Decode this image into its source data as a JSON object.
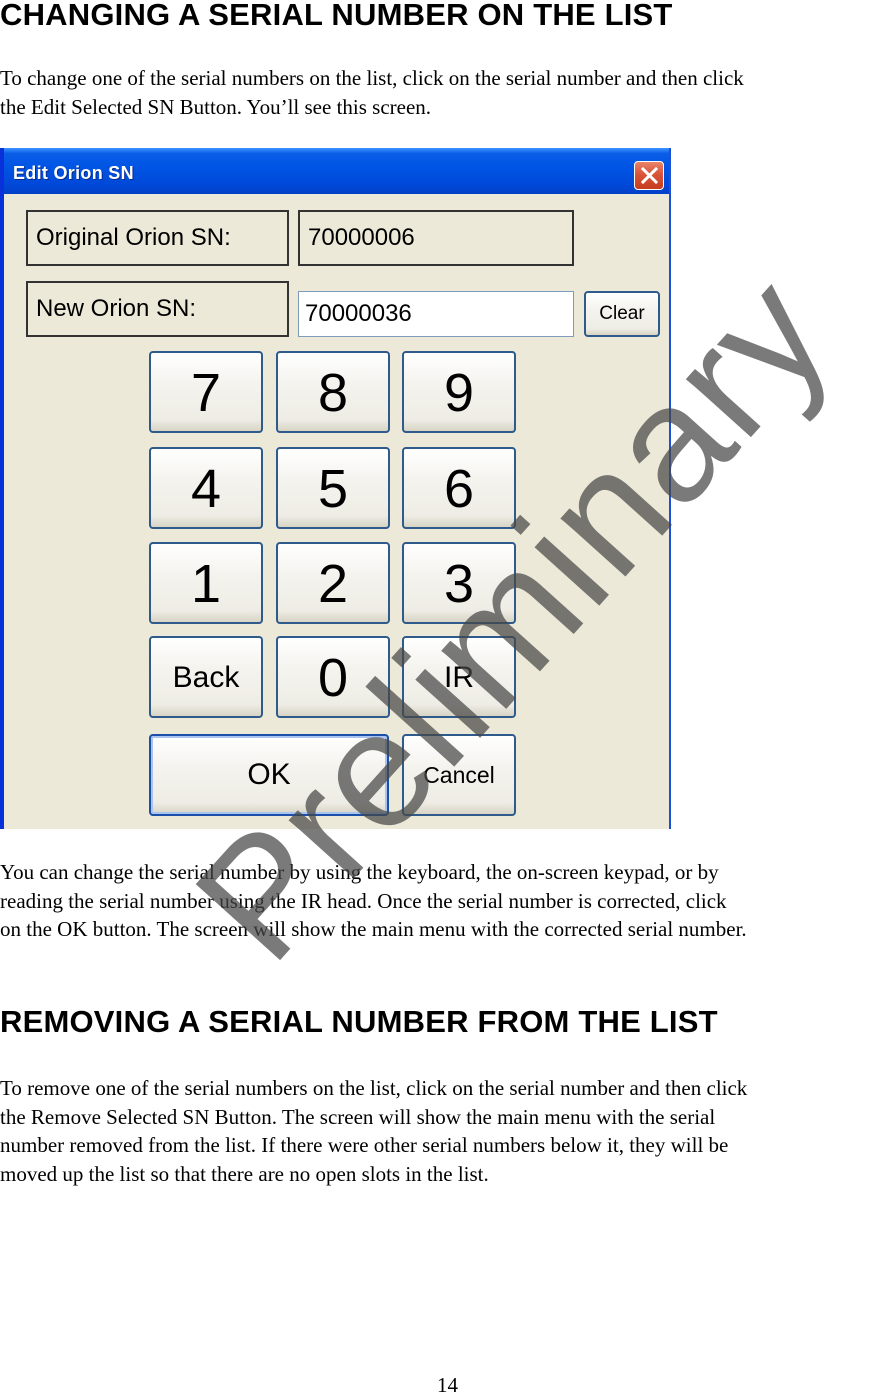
{
  "section1": {
    "heading": "CHANGING A SERIAL NUMBER ON THE LIST",
    "intro": "To change one of the serial numbers on the list, click on the serial number and then click\nthe Edit Selected SN Button.  You’ll see this screen.",
    "after": "You can change the serial number by using the keyboard, the on-screen keypad, or by\nreading the serial number using the IR head.  Once the serial number is corrected, click\non the OK button.  The screen will show the main menu with the corrected serial number."
  },
  "dialog": {
    "title": "Edit Orion SN",
    "close_icon": "close-x-icon",
    "original_label": "Original Orion SN:",
    "original_value": "70000006",
    "new_label": "New Orion SN:",
    "new_value": "70000036",
    "clear_label": "Clear",
    "keypad": {
      "row1": [
        "7",
        "8",
        "9"
      ],
      "row2": [
        "4",
        "5",
        "6"
      ],
      "row3": [
        "1",
        "2",
        "3"
      ],
      "row4": [
        "Back",
        "0",
        "IR"
      ]
    },
    "ok_label": "OK",
    "cancel_label": "Cancel",
    "colors": {
      "titlebar": "#0055e5",
      "body": "#ece9d8",
      "close_button": "#d9553a",
      "button_border": "#2e5a8c"
    }
  },
  "section2": {
    "heading": "REMOVING A SERIAL NUMBER FROM THE LIST",
    "body": "To remove one of the serial numbers on the list, click on the serial number and then click\nthe Remove Selected SN Button.  The screen will show the main menu with the serial\nnumber removed from the list.  If there were other serial numbers below it, they will be\nmoved up the list so that there are no open slots in the list."
  },
  "watermark": "Preliminary",
  "page_number": "14"
}
